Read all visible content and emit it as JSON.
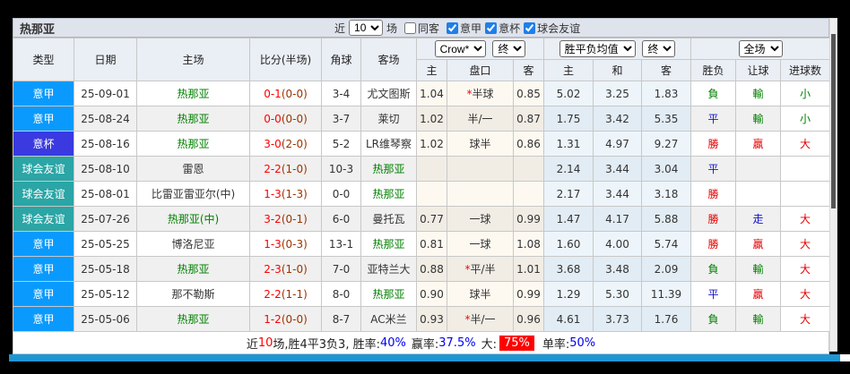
{
  "title": "热那亚",
  "toolbar": {
    "near_label": "近",
    "matches_count": "10",
    "matches_label": "场",
    "same_away_label": "同客",
    "same_away_checked": false,
    "league_filters": [
      {
        "label": "意甲",
        "checked": true
      },
      {
        "label": "意杯",
        "checked": true
      },
      {
        "label": "球会友谊",
        "checked": true
      }
    ]
  },
  "header": {
    "type": "类型",
    "date": "日期",
    "home": "主场",
    "score": "比分(半场)",
    "corner": "角球",
    "away": "客场",
    "bookmaker_select": "Crow*",
    "bookmaker_final_select": "终",
    "avg_select": "胜平负均值",
    "avg_final_select": "终",
    "scope_select": "全场",
    "odds_home": "主",
    "odds_handicap": "盘口",
    "odds_away": "客",
    "avg_home": "主",
    "avg_draw": "和",
    "avg_away": "客",
    "result_wdl": "胜负",
    "result_handicap": "让球",
    "result_goals": "进球数"
  },
  "rows": [
    {
      "league": "意甲",
      "league_type": "serie",
      "date": "25-09-01",
      "home": "热那亚",
      "home_is_self": true,
      "score": "0-1",
      "half_score": "(0-0)",
      "corners": "3-4",
      "away": "尤文图斯",
      "away_is_self": false,
      "odds_home": "1.04",
      "handicap": "*半球",
      "odds_away": "0.85",
      "avg_home": "5.02",
      "avg_draw": "3.25",
      "avg_away": "1.83",
      "result_wdl": "負",
      "result_wdl_color": "g",
      "result_handicap": "輸",
      "result_handicap_color": "g",
      "result_goals": "小",
      "result_goals_color": "g"
    },
    {
      "league": "意甲",
      "league_type": "serie",
      "date": "25-08-24",
      "home": "热那亚",
      "home_is_self": true,
      "score": "0-0",
      "half_score": "(0-0)",
      "corners": "3-7",
      "away": "莱切",
      "away_is_self": false,
      "odds_home": "1.02",
      "handicap": "半/一",
      "odds_away": "0.87",
      "avg_home": "1.75",
      "avg_draw": "3.42",
      "avg_away": "5.35",
      "result_wdl": "平",
      "result_wdl_color": "b",
      "result_handicap": "輸",
      "result_handicap_color": "g",
      "result_goals": "小",
      "result_goals_color": "g"
    },
    {
      "league": "意杯",
      "league_type": "cup",
      "date": "25-08-16",
      "home": "热那亚",
      "home_is_self": true,
      "score": "3-0",
      "half_score": "(2-0)",
      "corners": "5-2",
      "away": "LR维琴察",
      "away_is_self": false,
      "odds_home": "1.02",
      "handicap": "球半",
      "odds_away": "0.86",
      "avg_home": "1.31",
      "avg_draw": "4.97",
      "avg_away": "9.27",
      "result_wdl": "勝",
      "result_wdl_color": "r",
      "result_handicap": "贏",
      "result_handicap_color": "r",
      "result_goals": "大",
      "result_goals_color": "r"
    },
    {
      "league": "球会友谊",
      "league_type": "friendly",
      "date": "25-08-10",
      "home": "雷恩",
      "home_is_self": false,
      "score": "2-2",
      "half_score": "(1-0)",
      "corners": "10-3",
      "away": "热那亚",
      "away_is_self": true,
      "odds_home": "",
      "handicap": "",
      "odds_away": "",
      "avg_home": "2.14",
      "avg_draw": "3.44",
      "avg_away": "3.04",
      "result_wdl": "平",
      "result_wdl_color": "b",
      "result_handicap": "",
      "result_handicap_color": "",
      "result_goals": "",
      "result_goals_color": ""
    },
    {
      "league": "球会友谊",
      "league_type": "friendly",
      "date": "25-08-01",
      "home": "比雷亚雷亚尔(中)",
      "home_is_self": false,
      "score": "1-3",
      "half_score": "(1-3)",
      "corners": "0-0",
      "away": "热那亚",
      "away_is_self": true,
      "odds_home": "",
      "handicap": "",
      "odds_away": "",
      "avg_home": "2.17",
      "avg_draw": "3.44",
      "avg_away": "3.18",
      "result_wdl": "勝",
      "result_wdl_color": "r",
      "result_handicap": "",
      "result_handicap_color": "",
      "result_goals": "",
      "result_goals_color": ""
    },
    {
      "league": "球会友谊",
      "league_type": "friendly",
      "date": "25-07-26",
      "home": "热那亚(中)",
      "home_is_self": true,
      "score": "3-2",
      "half_score": "(0-1)",
      "corners": "6-0",
      "away": "曼托瓦",
      "away_is_self": false,
      "odds_home": "0.77",
      "handicap": "一球",
      "odds_away": "0.99",
      "avg_home": "1.47",
      "avg_draw": "4.17",
      "avg_away": "5.88",
      "result_wdl": "勝",
      "result_wdl_color": "r",
      "result_handicap": "走",
      "result_handicap_color": "b",
      "result_goals": "大",
      "result_goals_color": "r"
    },
    {
      "league": "意甲",
      "league_type": "serie",
      "date": "25-05-25",
      "home": "博洛尼亚",
      "home_is_self": false,
      "score": "1-3",
      "half_score": "(0-3)",
      "corners": "13-1",
      "away": "热那亚",
      "away_is_self": true,
      "odds_home": "0.81",
      "handicap": "一球",
      "odds_away": "1.08",
      "avg_home": "1.60",
      "avg_draw": "4.00",
      "avg_away": "5.74",
      "result_wdl": "勝",
      "result_wdl_color": "r",
      "result_handicap": "贏",
      "result_handicap_color": "r",
      "result_goals": "大",
      "result_goals_color": "r"
    },
    {
      "league": "意甲",
      "league_type": "serie",
      "date": "25-05-18",
      "home": "热那亚",
      "home_is_self": true,
      "score": "2-3",
      "half_score": "(1-0)",
      "corners": "7-0",
      "away": "亚特兰大",
      "away_is_self": false,
      "odds_home": "0.88",
      "handicap": "*平/半",
      "odds_away": "1.01",
      "avg_home": "3.68",
      "avg_draw": "3.48",
      "avg_away": "2.09",
      "result_wdl": "負",
      "result_wdl_color": "g",
      "result_handicap": "輸",
      "result_handicap_color": "g",
      "result_goals": "大",
      "result_goals_color": "r"
    },
    {
      "league": "意甲",
      "league_type": "serie",
      "date": "25-05-12",
      "home": "那不勒斯",
      "home_is_self": false,
      "score": "2-2",
      "half_score": "(1-1)",
      "corners": "8-0",
      "away": "热那亚",
      "away_is_self": true,
      "odds_home": "0.90",
      "handicap": "球半",
      "odds_away": "0.99",
      "avg_home": "1.29",
      "avg_draw": "5.30",
      "avg_away": "11.39",
      "result_wdl": "平",
      "result_wdl_color": "b",
      "result_handicap": "贏",
      "result_handicap_color": "r",
      "result_goals": "大",
      "result_goals_color": "r"
    },
    {
      "league": "意甲",
      "league_type": "serie",
      "date": "25-05-06",
      "home": "热那亚",
      "home_is_self": true,
      "score": "1-2",
      "half_score": "(0-0)",
      "corners": "8-7",
      "away": "AC米兰",
      "away_is_self": false,
      "odds_home": "0.93",
      "handicap": "*半/一",
      "odds_away": "0.96",
      "avg_home": "4.61",
      "avg_draw": "3.73",
      "avg_away": "1.76",
      "result_wdl": "負",
      "result_wdl_color": "g",
      "result_handicap": "輸",
      "result_handicap_color": "g",
      "result_goals": "大",
      "result_goals_color": "r"
    }
  ],
  "summary": {
    "pre": "近",
    "count": "10",
    "mid": "场,胜4平3负3, 胜率:",
    "win_rate": "40%",
    "handicap_label": "赢率:",
    "handicap_rate": "37.5%",
    "big_label": "大:",
    "big_rate": "75%",
    "odd_label": "单率:",
    "odd_rate": "50%"
  },
  "colors": {
    "serie_a_badge": "#0a9afd",
    "cup_badge": "#3a3ae0",
    "friendly_badge": "#2ba5a5",
    "self_team": "#008000",
    "score": "#ff0000",
    "half_score": "#993300",
    "win": "#e60000",
    "draw": "#1414cc",
    "lose": "#008000",
    "big_badge_bg": "#ff0000",
    "bottom_bar": "#1f96d3"
  }
}
